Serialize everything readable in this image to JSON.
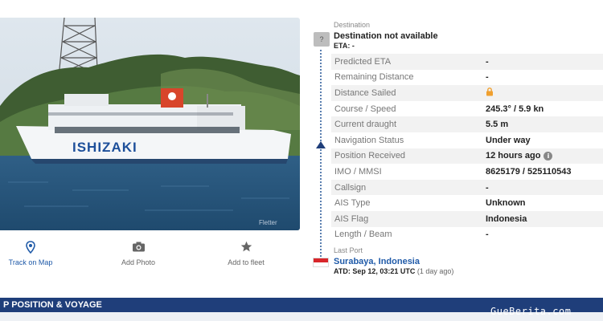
{
  "destination": {
    "label": "Destination",
    "icon": "question-mark-icon",
    "icon_text": "?",
    "value": "Destination not available",
    "eta": "ETA: -"
  },
  "photo": {
    "ship_name": "ISHIZAKI",
    "photo_credit": "Fletter"
  },
  "actions": {
    "track_label": "Track on Map",
    "track_icon": "map-pin-icon",
    "add_photo_label": "Add Photo",
    "add_photo_icon": "camera-icon",
    "add_fleet_label": "Add to fleet",
    "add_fleet_icon": "star-icon"
  },
  "details": [
    {
      "key": "Predicted ETA",
      "value": "-"
    },
    {
      "key": "Remaining Distance",
      "value": "-"
    },
    {
      "key": "Distance Sailed",
      "value": "",
      "icon": "lock-icon"
    },
    {
      "key": "Course / Speed",
      "value": "245.3° / 5.9 kn"
    },
    {
      "key": "Current draught",
      "value": "5.5 m"
    },
    {
      "key": "Navigation Status",
      "value": "Under way"
    },
    {
      "key": "Position Received",
      "value": "12 hours ago",
      "icon": "info-icon"
    },
    {
      "key": "IMO / MMSI",
      "value": "8625179 / 525110543"
    },
    {
      "key": "Callsign",
      "value": "-"
    },
    {
      "key": "AIS Type",
      "value": "Unknown"
    },
    {
      "key": "AIS Flag",
      "value": "Indonesia"
    },
    {
      "key": "Length / Beam",
      "value": "-"
    }
  ],
  "last_port": {
    "label": "Last Port",
    "flag_icon": "indonesia-flag-icon",
    "name": "Surabaya, Indonesia",
    "atd": "ATD: Sep 12, 03:21 UTC",
    "ago": "(1 day ago)"
  },
  "section_bar": {
    "title": "P POSITION & VOYAGE"
  },
  "watermark": "GueBerita.com",
  "colors": {
    "accent": "#1f5aa8",
    "bar": "#1f3e7a",
    "lock": "#f0a030",
    "flag_red": "#d8262b"
  }
}
